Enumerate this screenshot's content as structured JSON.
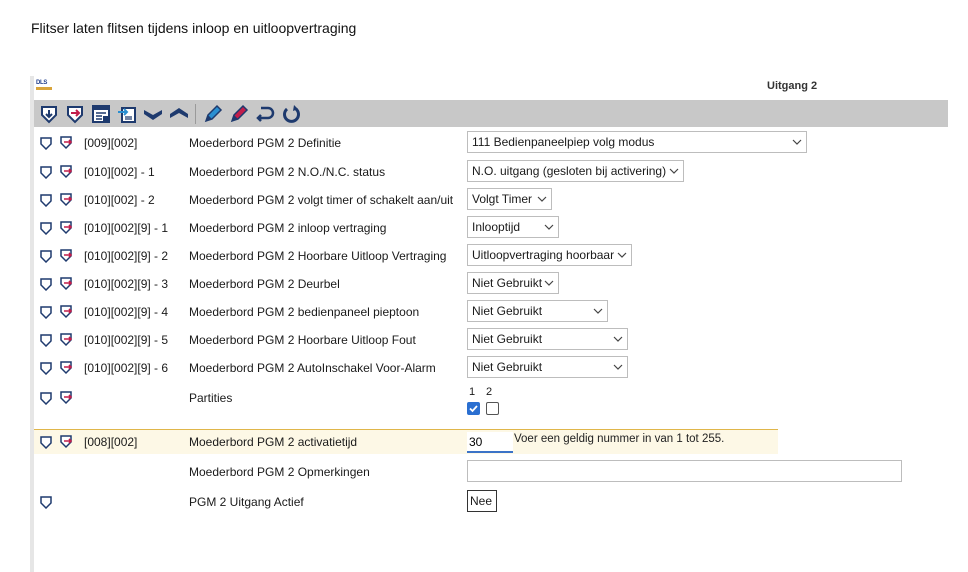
{
  "caption": "Flitser laten flitsen tijdens inloop en uitloopvertraging",
  "panel": {
    "logo_text": "DLS",
    "title": "Uitgang 2"
  },
  "toolbar": {
    "buttons": [
      "download-icon",
      "upload-icon",
      "save-table-icon",
      "transfer-icon",
      "chevron-down-icon",
      "chevron-up-icon",
      "edit-pencil-icon",
      "edit-pencil-alt-icon",
      "undo-icon",
      "refresh-icon"
    ]
  },
  "rows": [
    {
      "code": "[009][002]",
      "label": "Moederbord PGM 2 Definitie",
      "value": "111 Bedienpaneelpiep volg modus"
    },
    {
      "code": "[010][002] - 1",
      "label": "Moederbord PGM 2 N.O./N.C. status",
      "value": "N.O. uitgang (gesloten bij activering)"
    },
    {
      "code": "[010][002] - 2",
      "label": "Moederbord PGM 2 volgt timer of schakelt aan/uit",
      "value": "Volgt Timer"
    },
    {
      "code": "[010][002][9] - 1",
      "label": "Moederbord PGM 2 inloop vertraging",
      "value": "Inlooptijd"
    },
    {
      "code": "[010][002][9] - 2",
      "label": "Moederbord PGM 2 Hoorbare Uitloop Vertraging",
      "value": "Uitloopvertraging hoorbaar"
    },
    {
      "code": "[010][002][9] - 3",
      "label": "Moederbord PGM 2 Deurbel",
      "value": "Niet Gebruikt"
    },
    {
      "code": "[010][002][9] - 4",
      "label": "Moederbord PGM 2 bedienpaneel pieptoon",
      "value": "Niet Gebruikt"
    },
    {
      "code": "[010][002][9] - 5",
      "label": "Moederbord PGM 2 Hoorbare Uitloop Fout",
      "value": "Niet Gebruikt"
    },
    {
      "code": "[010][002][9] - 6",
      "label": "Moederbord PGM 2 AutoInschakel Voor-Alarm",
      "value": "Niet Gebruikt"
    }
  ],
  "partities": {
    "label": "Partities",
    "items": [
      {
        "num": "1",
        "checked": true
      },
      {
        "num": "2",
        "checked": false
      }
    ]
  },
  "activatietijd": {
    "code": "[008][002]",
    "label": "Moederbord PGM 2 activatietijd",
    "value": "30",
    "hint": "Voer een geldig nummer in van  1 tot 255."
  },
  "opmerkingen": {
    "label": "Moederbord PGM 2 Opmerkingen",
    "value": ""
  },
  "uitgang_actief": {
    "label": "PGM 2 Uitgang Actief",
    "value": "Nee"
  },
  "colors": {
    "toolbar_bg": "#c8c8c8",
    "active_row_bg": "#fdf8e6",
    "active_row_border": "#e0b64a",
    "accent": "#2a6fd1"
  }
}
